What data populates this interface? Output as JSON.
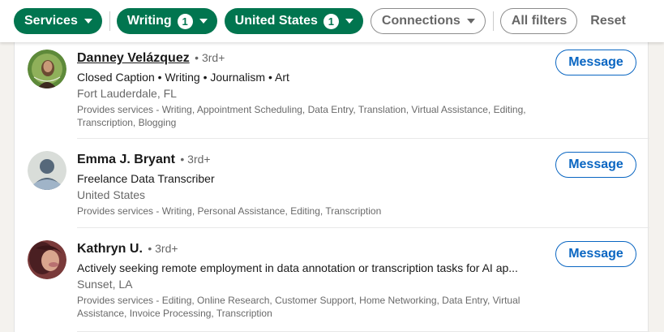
{
  "filters": {
    "services": {
      "label": "Services"
    },
    "writing": {
      "label": "Writing",
      "count": "1"
    },
    "location": {
      "label": "United States",
      "count": "1"
    },
    "connections": {
      "label": "Connections"
    },
    "all_filters": {
      "label": "All filters"
    },
    "reset": {
      "label": "Reset"
    }
  },
  "colors": {
    "accent_green": "#01754f",
    "link_blue": "#0a66c2"
  },
  "results": [
    {
      "name": "Danney Velázquez",
      "degree": "• 3rd+",
      "headline": "Closed Caption • Writing • Journalism • Art",
      "location": "Fort Lauderdale, FL",
      "services": "Provides services - Writing, Appointment Scheduling, Data Entry, Translation, Virtual Assistance, Editing, Transcription, Blogging",
      "button": "Message"
    },
    {
      "name": "Emma J. Bryant",
      "degree": "• 3rd+",
      "headline": "Freelance Data Transcriber",
      "location": "United States",
      "services": "Provides services - Writing, Personal Assistance, Editing, Transcription",
      "button": "Message"
    },
    {
      "name": "Kathryn U.",
      "degree": "• 3rd+",
      "headline": "Actively seeking remote employment in data annotation or transcription tasks for AI ap...",
      "location": "Sunset, LA",
      "services": "Provides services - Editing, Online Research, Customer Support, Home Networking, Data Entry, Virtual Assistance, Invoice Processing, Transcription",
      "button": "Message"
    }
  ]
}
